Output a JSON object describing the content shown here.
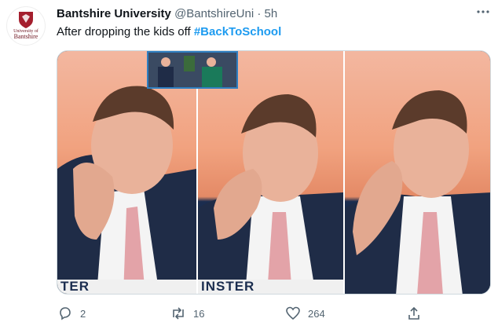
{
  "account": {
    "name": "Bantshire University",
    "handle": "@BantshireUni",
    "separator": "·",
    "time": "5h",
    "avatar_lines": [
      "University of",
      "Bantshire"
    ]
  },
  "tweet": {
    "text": "After dropping the kids off ",
    "hashtag": "#BackToSchool"
  },
  "media": {
    "lower_third_1": "TER",
    "lower_third_2": "INSTER"
  },
  "actions": {
    "reply_count": "2",
    "retweet_count": "16",
    "like_count": "264"
  },
  "colors": {
    "link": "#1d9bf0",
    "muted": "#536471",
    "brand": "#a41e2d"
  },
  "icons": {
    "more": "more-icon",
    "reply": "reply-icon",
    "retweet": "retweet-icon",
    "like": "like-icon",
    "share": "share-icon"
  }
}
